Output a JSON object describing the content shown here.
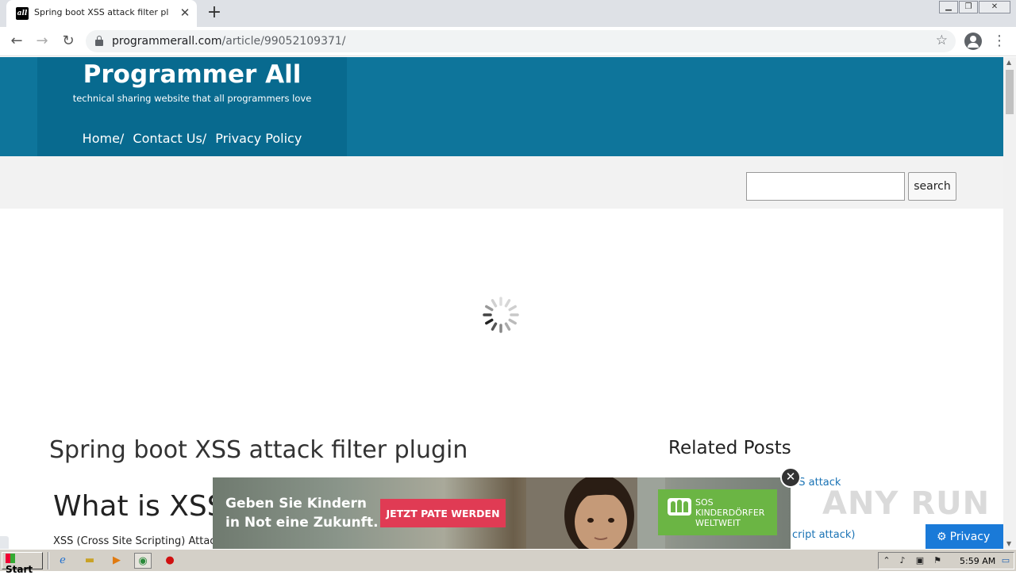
{
  "browser": {
    "tab_title": "Spring boot XSS attack filter plugin -",
    "tab_favicon_text": "all",
    "tab_close": "✕",
    "new_tab": "+",
    "url_host": "programmerall.com",
    "url_path": "/article/99052109371/",
    "window_controls": [
      "minimize-icon",
      "restore-icon",
      "close-icon"
    ]
  },
  "site": {
    "title": "Programmer All",
    "tagline": "technical sharing website that all programmers love",
    "nav": [
      {
        "label": "Home",
        "sep": "/"
      },
      {
        "label": "Contact Us",
        "sep": "/"
      },
      {
        "label": "Privacy Policy",
        "sep": ""
      }
    ],
    "search_button": "search",
    "search_value": ""
  },
  "article": {
    "title": "Spring boot XSS attack filter plugin",
    "heading": "What is XSS?",
    "body_start": "XSS (Cross Site Scripting) Attac"
  },
  "sidebar": {
    "related_title": "Related Posts",
    "related_link_1": "SS attack",
    "related_link_2": "cript attack)"
  },
  "ad": {
    "headline_1": "Geben Sie Kindern",
    "headline_2": "in Not eine Zukunft.",
    "cta": "JETZT PATE WERDEN",
    "sos_name": "SOS\nKINDERDÖRFER\nWELTWEIT",
    "close": "✕"
  },
  "overlay": {
    "watermark": "ANY RUN",
    "privacy_button": "Privacy"
  },
  "taskbar": {
    "start": "Start",
    "time": "5:59 AM"
  },
  "colors": {
    "header_bg": "#0e759b",
    "brand_box_bg": "#086a8f",
    "link": "#1a73b5",
    "ad_cta": "#e03b54",
    "ad_sos": "#6bb544",
    "privacy": "#1a7ad8"
  }
}
